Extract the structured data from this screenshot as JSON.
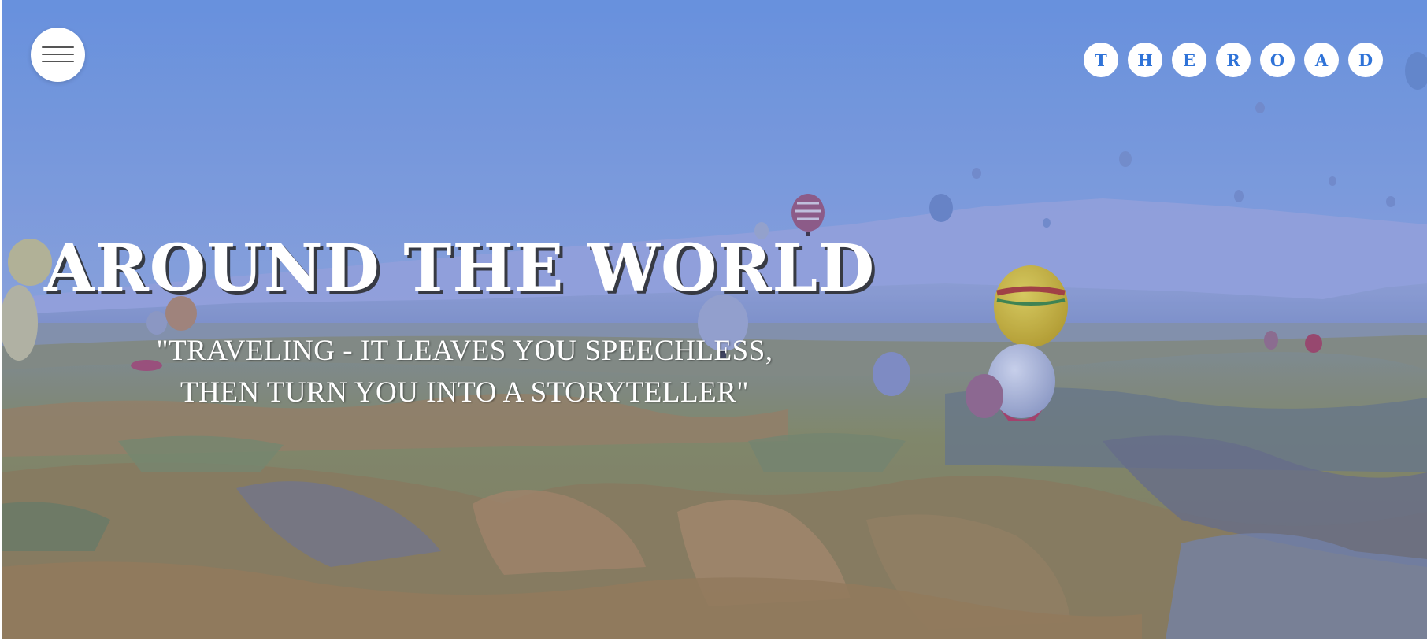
{
  "header": {
    "menu_icon": "hamburger-icon",
    "brand_letters": [
      "T",
      "H",
      "E",
      "R",
      "O",
      "A",
      "D"
    ]
  },
  "hero": {
    "background": "hot-air-balloons-over-valley-landscape",
    "title": "AROUND THE WORLD",
    "quote_lines": [
      "\"TRAVELING - IT LEAVES YOU SPEECHLESS,",
      "THEN TURN YOU INTO A STORYTELLER\""
    ]
  },
  "colors": {
    "brand_letter": "#2f73d8",
    "sky_top": "#7096dd",
    "overlay": "#4a64c8"
  }
}
